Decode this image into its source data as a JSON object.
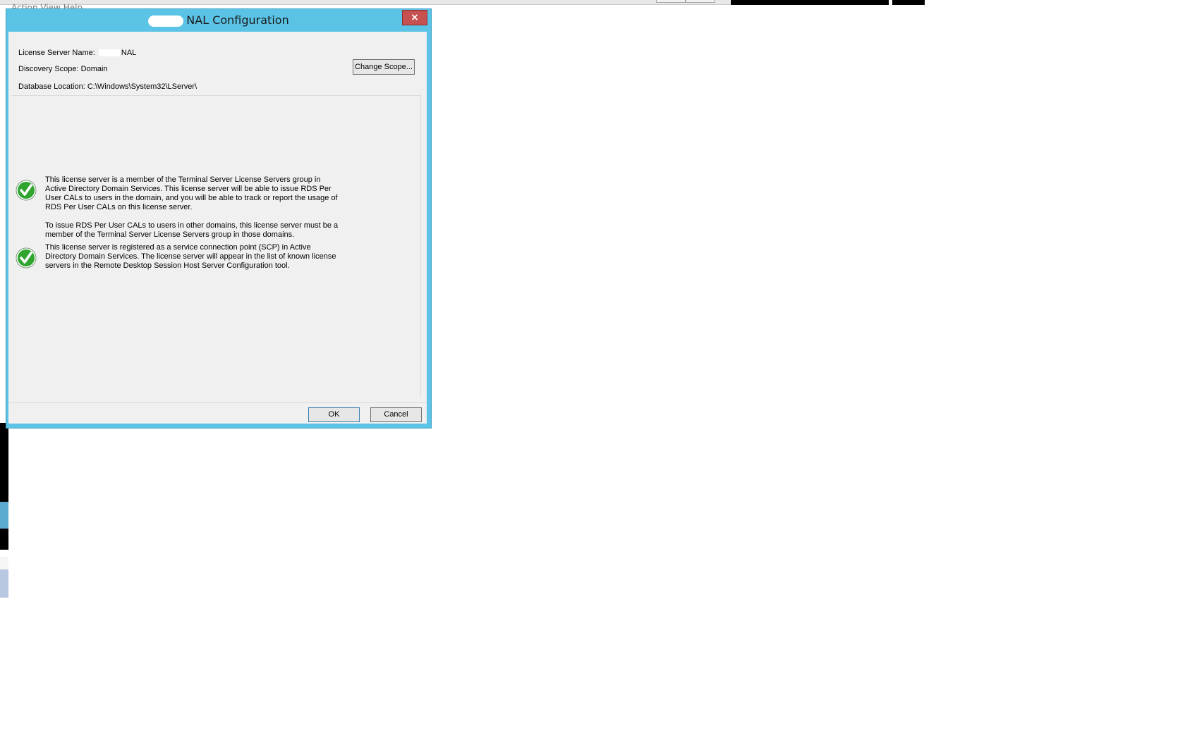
{
  "background": {
    "menu_text": "Action   View   Help"
  },
  "dialog": {
    "title_suffix": "NAL Configuration",
    "close_label": "×",
    "license_server_label": "License Server Name:",
    "license_server_value": "NAL",
    "discovery_scope": "Discovery Scope: Domain",
    "change_scope_label": "Change Scope...",
    "database_location": "Database Location: C:\\Windows\\System32\\LServer\\",
    "messages": [
      {
        "p1": "This license server is a member of the Terminal Server License Servers group in Active Directory Domain Services. This license server will be able to issue RDS Per User CALs to users in the domain, and you will be able to track or report the usage of RDS Per User CALs on this license server.",
        "p2": "To issue RDS Per User CALs to users in other domains, this license server must be a member of the Terminal Server License Servers group in those domains."
      },
      {
        "p1": "This license server is registered as a service connection point (SCP) in Active Directory Domain Services. The license server will appear in the list of known license servers in the Remote Desktop Session Host Server Configuration tool."
      }
    ],
    "ok_label": "OK",
    "cancel_label": "Cancel"
  },
  "colors": {
    "titlebar": "#5bc3e6",
    "close": "#c75050",
    "check": "#2fa52f"
  }
}
